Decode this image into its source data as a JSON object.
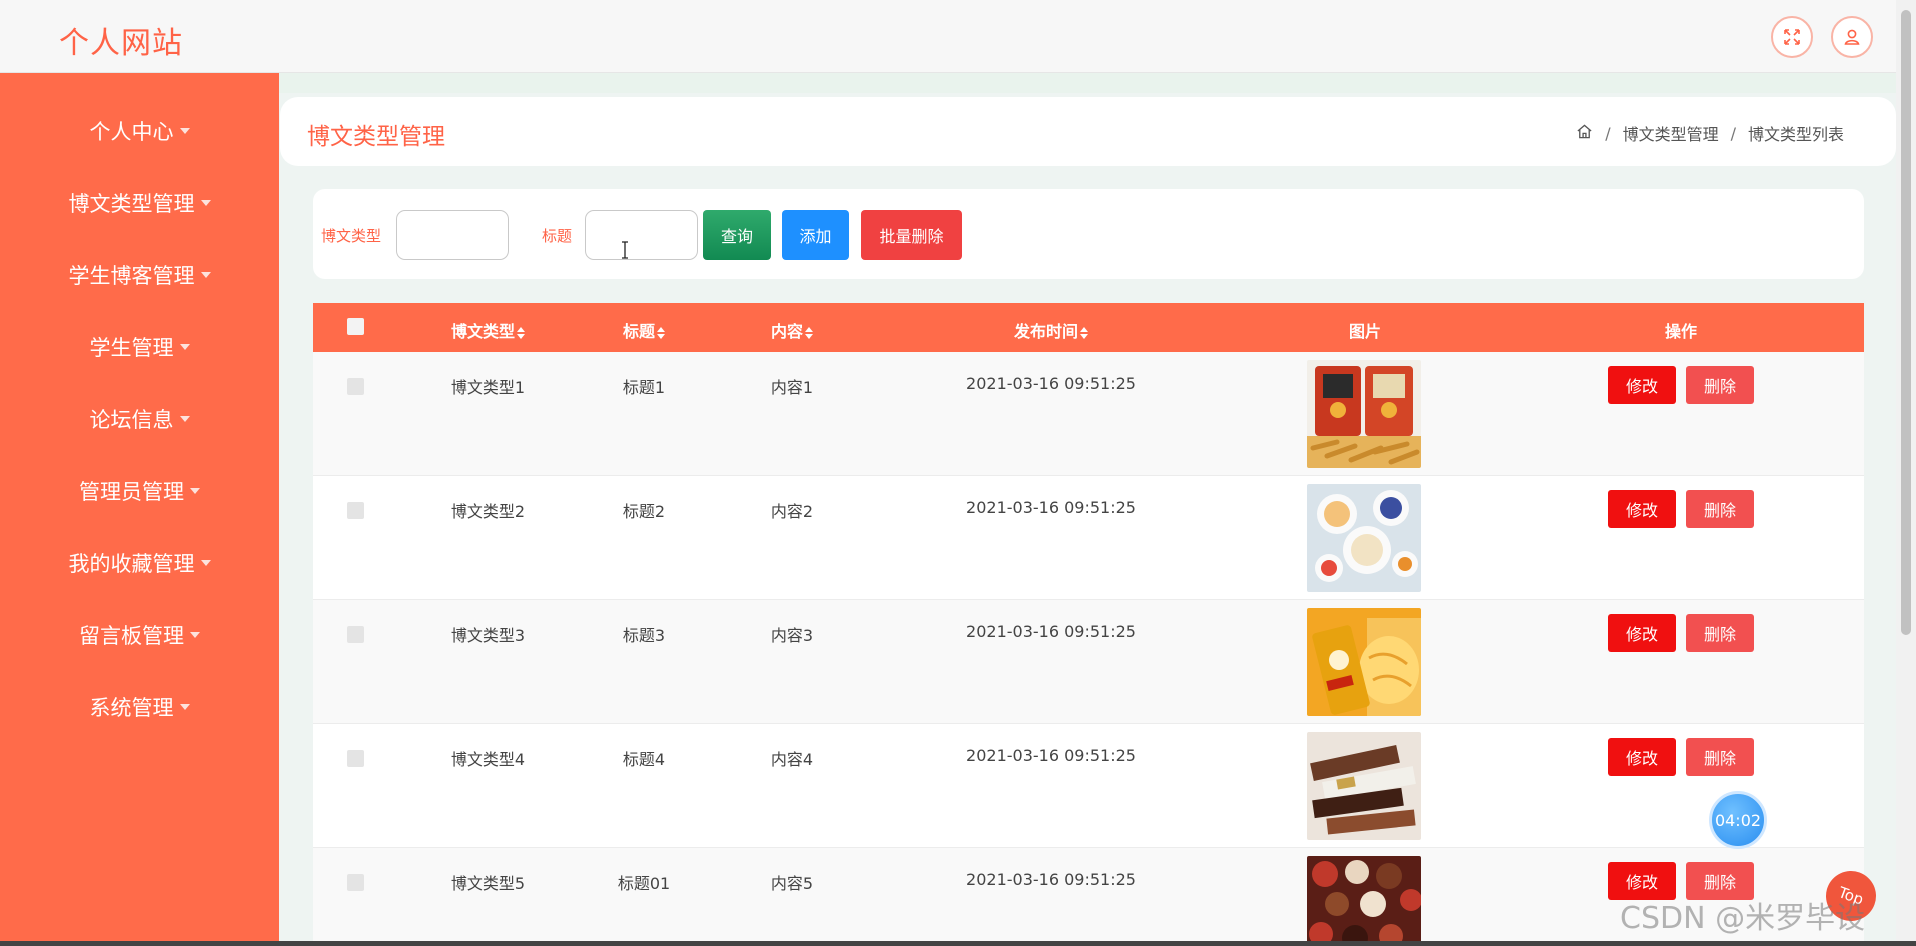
{
  "header": {
    "site_title": "个人网站"
  },
  "sidebar": {
    "items": [
      {
        "label": "个人中心"
      },
      {
        "label": "博文类型管理"
      },
      {
        "label": "学生博客管理"
      },
      {
        "label": "学生管理"
      },
      {
        "label": "论坛信息"
      },
      {
        "label": "管理员管理"
      },
      {
        "label": "我的收藏管理"
      },
      {
        "label": "留言板管理"
      },
      {
        "label": "系统管理"
      }
    ]
  },
  "page": {
    "title": "博文类型管理",
    "breadcrumb": [
      "博文类型管理",
      "博文类型列表"
    ]
  },
  "search": {
    "type_label": "博文类型",
    "type_value": "",
    "title_label": "标题",
    "title_value": "",
    "query_label": "查询",
    "add_label": "添加",
    "batch_delete_label": "批量删除"
  },
  "table": {
    "columns": [
      "博文类型",
      "标题",
      "内容",
      "发布时间",
      "图片",
      "操作"
    ],
    "edit_label": "修改",
    "delete_label": "删除",
    "rows": [
      {
        "type": "博文类型1",
        "title": "标题1",
        "content": "内容1",
        "time": "2021-03-16 09:51:25",
        "image": "snack-bag"
      },
      {
        "type": "博文类型2",
        "title": "标题2",
        "content": "内容2",
        "time": "2021-03-16 09:51:25",
        "image": "yogurt-bowls"
      },
      {
        "type": "博文类型3",
        "title": "标题3",
        "content": "内容3",
        "time": "2021-03-16 09:51:25",
        "image": "chips-can"
      },
      {
        "type": "博文类型4",
        "title": "标题4",
        "content": "内容4",
        "time": "2021-03-16 09:51:25",
        "image": "candy-bars"
      },
      {
        "type": "博文类型5",
        "title": "标题01",
        "content": "内容5",
        "time": "2021-03-16 09:51:25",
        "image": "chocolates"
      }
    ]
  },
  "overlay": {
    "timer": "04:02",
    "to_top": "Top",
    "watermark": "CSDN @米罗毕设"
  },
  "colors": {
    "accent": "#ff6347",
    "sidebar": "#ff6b4a",
    "query": "#1f9a5e",
    "add": "#1e90ff",
    "danger": "#f04141"
  }
}
